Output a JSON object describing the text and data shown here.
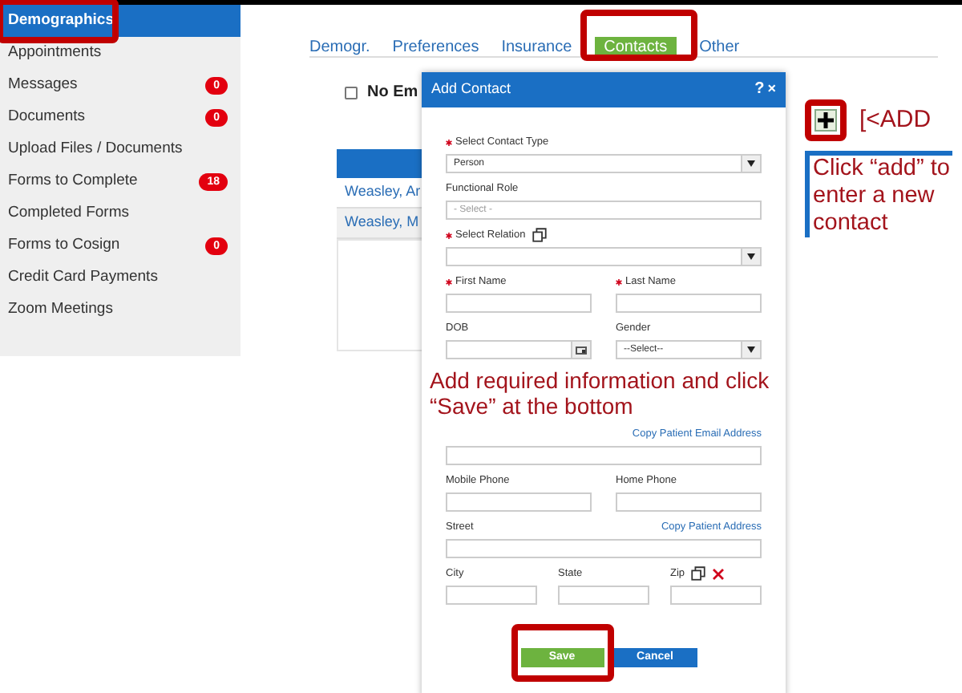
{
  "sidebar": {
    "items": [
      {
        "label": "Demographics",
        "selected": true,
        "highlighted": true
      },
      {
        "label": "Appointments",
        "selected": false
      },
      {
        "label": "Messages",
        "selected": false,
        "badge": "0"
      },
      {
        "label": "Documents",
        "selected": false,
        "badge": "0"
      },
      {
        "label": "Upload Files / Documents",
        "selected": false
      },
      {
        "label": "Forms to Complete",
        "selected": false,
        "badge": "18"
      },
      {
        "label": "Completed Forms",
        "selected": false
      },
      {
        "label": "Forms to Cosign",
        "selected": false,
        "badge": "0"
      },
      {
        "label": "Credit Card Payments",
        "selected": false
      },
      {
        "label": "Zoom Meetings",
        "selected": false
      }
    ]
  },
  "tabs": [
    {
      "label": "Demogr.",
      "selected": false
    },
    {
      "label": "Preferences",
      "selected": false
    },
    {
      "label": "Insurance",
      "selected": false
    },
    {
      "label": "Contacts",
      "selected": true,
      "highlighted": true
    },
    {
      "label": "Other",
      "selected": false
    }
  ],
  "no_emergency": {
    "label": "No Em",
    "checked": false
  },
  "contacts_table": {
    "rows": [
      "Weasley, Ar",
      "Weasley, M"
    ]
  },
  "add_callout": {
    "label": "[<ADD",
    "note": "Click “add” to enter a new contact"
  },
  "dialog": {
    "title": "Add Contact",
    "help": "?",
    "close": "×",
    "rows": [
      [
        {
          "kind": "select",
          "label": "Select Contact Type",
          "required": true,
          "value": "Person"
        }
      ],
      [
        {
          "kind": "input",
          "label": "Functional Role",
          "required": false,
          "placeholder": "- Select -"
        }
      ],
      [
        {
          "kind": "select",
          "label": "Select Relation",
          "required": true,
          "copy_icon": true
        }
      ],
      [
        {
          "kind": "input",
          "label": "First Name",
          "required": true
        },
        {
          "kind": "input",
          "label": "Last Name",
          "required": true
        }
      ],
      [
        {
          "kind": "date",
          "label": "DOB",
          "required": false
        },
        {
          "kind": "select",
          "label": "Gender",
          "required": false,
          "value": "--Select--"
        }
      ],
      [
        {
          "kind": "note",
          "text": "Add required information and click “Save” at the bottom"
        }
      ],
      [
        {
          "kind": "input",
          "link": "Copy Patient Email Address"
        }
      ],
      [
        {
          "kind": "input",
          "label": "Mobile Phone",
          "required": false
        },
        {
          "kind": "input",
          "label": "Home Phone",
          "required": false
        }
      ],
      [
        {
          "kind": "input",
          "label": "Street",
          "required": false,
          "link": "Copy Patient Address"
        }
      ],
      [
        {
          "kind": "input",
          "label": "City",
          "required": false
        },
        {
          "kind": "input",
          "label": "State",
          "required": false
        },
        {
          "kind": "input",
          "label": "Zip",
          "required": false,
          "copy_icon": true,
          "clear_icon": true
        }
      ]
    ],
    "buttons": [
      {
        "kind": "save",
        "label": "Save",
        "highlighted": true
      },
      {
        "kind": "cancel",
        "label": "Cancel",
        "highlighted": false
      }
    ]
  }
}
